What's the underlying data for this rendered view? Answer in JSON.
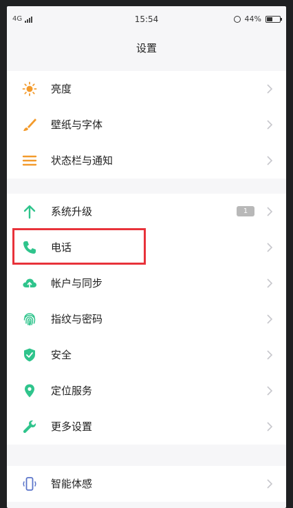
{
  "statusbar": {
    "network": "4G",
    "time": "15:54",
    "battery": "44%",
    "battery_level": 0.44
  },
  "header": {
    "title": "设置"
  },
  "groups": [
    {
      "items": [
        {
          "label": "亮度",
          "icon": "brightness-icon",
          "color": "#f39a2b"
        },
        {
          "label": "壁纸与字体",
          "icon": "brush-icon",
          "color": "#f39a2b"
        },
        {
          "label": "状态栏与通知",
          "icon": "menu-list-icon",
          "color": "#f39a2b"
        }
      ]
    },
    {
      "items": [
        {
          "label": "系统升级",
          "icon": "arrow-up-icon",
          "color": "#2fc48c",
          "badge": "1"
        },
        {
          "label": "电话",
          "icon": "phone-icon",
          "color": "#2fc48c"
        },
        {
          "label": "帐户与同步",
          "icon": "cloud-sync-icon",
          "color": "#2fc48c"
        },
        {
          "label": "指纹与密码",
          "icon": "fingerprint-icon",
          "color": "#2fc48c"
        },
        {
          "label": "安全",
          "icon": "shield-icon",
          "color": "#2fc48c"
        },
        {
          "label": "定位服务",
          "icon": "location-pin-icon",
          "color": "#2fc48c"
        },
        {
          "label": "更多设置",
          "icon": "wrench-icon",
          "color": "#2fc48c"
        }
      ]
    },
    {
      "items": [
        {
          "label": "智能体感",
          "icon": "phone-motion-icon",
          "color": "#5a74c9"
        }
      ]
    }
  ],
  "highlight_color": "#e8323a"
}
